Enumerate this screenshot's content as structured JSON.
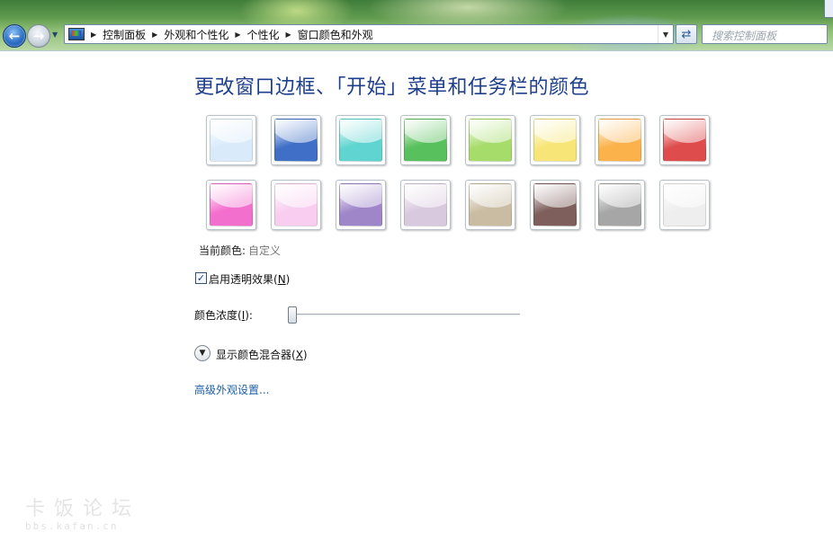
{
  "toolbar": {
    "breadcrumb": [
      "控制面板",
      "外观和个性化",
      "个性化",
      "窗口颜色和外观"
    ],
    "search_placeholder": "搜索控制面板"
  },
  "main": {
    "title": "更改窗口边框、「开始」菜单和任务栏的颜色",
    "current_color_label": "当前颜色:",
    "current_color_value": "自定义",
    "transparency_label": "启用透明效果(",
    "transparency_key": "N",
    "transparency_checked": true,
    "intensity_label": "颜色浓度(",
    "intensity_key": "I",
    "intensity_level": 0,
    "mixer_label": "显示颜色混合器(",
    "mixer_key": "X",
    "advanced_link": "高级外观设置..."
  },
  "swatches": [
    {
      "name": "sky",
      "color": "#d9ebfb"
    },
    {
      "name": "twilight",
      "color": "#3f6fc6"
    },
    {
      "name": "sea",
      "color": "#5fd4d0"
    },
    {
      "name": "leaf",
      "color": "#58c05c"
    },
    {
      "name": "lime",
      "color": "#a6dc6a"
    },
    {
      "name": "sun",
      "color": "#f7e677"
    },
    {
      "name": "pumpkin",
      "color": "#fbb24a"
    },
    {
      "name": "ruby",
      "color": "#de4c4c"
    },
    {
      "name": "fuchsia",
      "color": "#f36fce"
    },
    {
      "name": "blush",
      "color": "#f8cdf0"
    },
    {
      "name": "violet",
      "color": "#9f86c9"
    },
    {
      "name": "lavender",
      "color": "#d9c9df"
    },
    {
      "name": "taupe",
      "color": "#c9bca2"
    },
    {
      "name": "chocolate",
      "color": "#7e5f5c"
    },
    {
      "name": "slate",
      "color": "#a6a6a6"
    },
    {
      "name": "frost",
      "color": "#eeeeee"
    }
  ],
  "watermark": {
    "title": "卡饭论坛",
    "url": "bbs.kafan.cn"
  }
}
